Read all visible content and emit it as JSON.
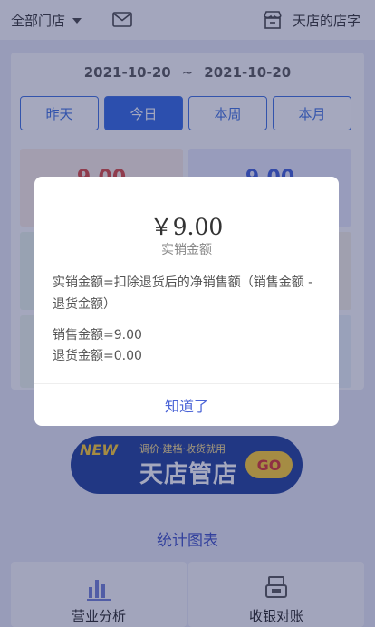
{
  "topbar": {
    "store_select": "全部门店",
    "shop_name": "天店的店字"
  },
  "date_range": {
    "start": "2021-10-20",
    "separator": "~",
    "end": "2021-10-20"
  },
  "tabs": [
    {
      "label": "昨天",
      "active": false
    },
    {
      "label": "今日",
      "active": true
    },
    {
      "label": "本周",
      "active": false
    },
    {
      "label": "本月",
      "active": false
    }
  ],
  "stats": {
    "cell1_value": "9.00",
    "cell2_value": "9.00"
  },
  "banner": {
    "new_tag": "NEW",
    "slogan": "调价·建档·收货就用",
    "brand": "天店管店",
    "go": "GO"
  },
  "section": {
    "title": "统计图表"
  },
  "features": [
    {
      "label": "营业分析",
      "icon": "bar-chart-icon"
    },
    {
      "label": "收银对账",
      "icon": "cashier-icon"
    }
  ],
  "modal": {
    "amount": "￥9.00",
    "amount_label": "实销金额",
    "description": "实销金额=扣除退货后的净销售额（销售金额 -退货金额）",
    "sales_line": "销售金额=9.00",
    "return_line": "退货金额=0.00",
    "confirm_label": "知道了"
  },
  "colors": {
    "accent": "#2f67e4",
    "link": "#4a63d6",
    "title_blue": "#3c4fc6",
    "red_value": "#d9453d"
  }
}
